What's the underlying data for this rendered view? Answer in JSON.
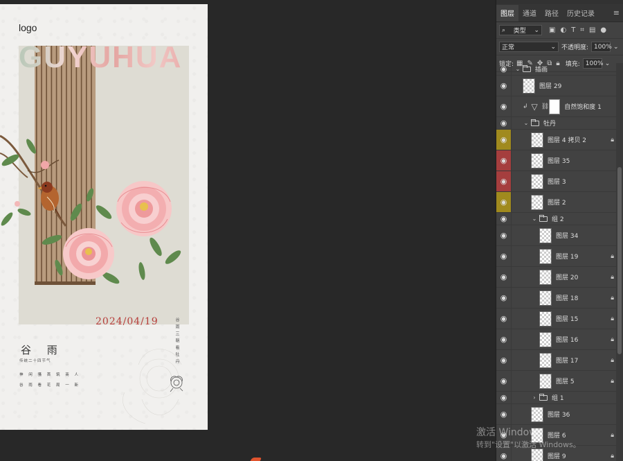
{
  "poster": {
    "logo": "logo",
    "big_title": "GUYUHUA",
    "date": "2024/04/19",
    "solar_term": "谷 雨",
    "solar_term_sub": "传统二十四节气",
    "poem_line1": "神 闲 骚 首 筑 商 人",
    "poem_line2": "谷 雨 看 花 局 一 新",
    "vertical_text": "谷雨三朝看牡丹"
  },
  "panel": {
    "tabs": [
      "图层",
      "通道",
      "路径",
      "历史记录"
    ],
    "active_tab": 0,
    "filter_kind": "类型",
    "blend_mode": "正常",
    "opacity_label": "不透明度:",
    "opacity_value": "100%",
    "lock_label": "锁定:",
    "fill_label": "填充:",
    "fill_value": "100%"
  },
  "layers": [
    {
      "type": "group",
      "name": "插画",
      "indent": 0,
      "expanded": true,
      "color": ""
    },
    {
      "type": "layer",
      "name": "图层 29",
      "indent": 1,
      "locked": false,
      "color": ""
    },
    {
      "type": "adjust",
      "name": "自然饱和度 1",
      "indent": 1,
      "locked": false,
      "color": ""
    },
    {
      "type": "group",
      "name": "牡丹",
      "indent": 1,
      "expanded": true,
      "color": ""
    },
    {
      "type": "layer",
      "name": "图层 4 拷贝 2",
      "indent": 2,
      "locked": true,
      "color": "yellow"
    },
    {
      "type": "layer",
      "name": "图层 35",
      "indent": 2,
      "locked": false,
      "color": "red"
    },
    {
      "type": "layer",
      "name": "图层 3",
      "indent": 2,
      "locked": false,
      "color": "red"
    },
    {
      "type": "layer",
      "name": "图层 2",
      "indent": 2,
      "locked": false,
      "color": "yellow"
    },
    {
      "type": "group",
      "name": "组 2",
      "indent": 2,
      "expanded": true,
      "color": ""
    },
    {
      "type": "layer",
      "name": "图层 34",
      "indent": 3,
      "locked": false,
      "color": ""
    },
    {
      "type": "layer",
      "name": "图层 19",
      "indent": 3,
      "locked": true,
      "color": ""
    },
    {
      "type": "layer",
      "name": "图层 20",
      "indent": 3,
      "locked": true,
      "color": ""
    },
    {
      "type": "layer",
      "name": "图层 18",
      "indent": 3,
      "locked": true,
      "color": ""
    },
    {
      "type": "layer",
      "name": "图层 15",
      "indent": 3,
      "locked": true,
      "color": ""
    },
    {
      "type": "layer",
      "name": "图层 16",
      "indent": 3,
      "locked": true,
      "color": ""
    },
    {
      "type": "layer",
      "name": "图层 17",
      "indent": 3,
      "locked": true,
      "color": ""
    },
    {
      "type": "layer",
      "name": "图层 5",
      "indent": 3,
      "locked": true,
      "color": ""
    },
    {
      "type": "group",
      "name": "组 1",
      "indent": 2,
      "expanded": false,
      "color": ""
    },
    {
      "type": "layer",
      "name": "图层 36",
      "indent": 2,
      "locked": false,
      "color": ""
    },
    {
      "type": "layer",
      "name": "图层 6",
      "indent": 2,
      "locked": true,
      "color": ""
    },
    {
      "type": "layer",
      "name": "图层 9",
      "indent": 2,
      "locked": true,
      "color": ""
    }
  ],
  "watermark": {
    "line1": "激活 Windows",
    "line2": "转到\"设置\"以激活 Windows。"
  },
  "colors": {
    "workspace": "#282828",
    "panel": "#424242",
    "date_red": "#b63d3a",
    "label_yellow": "#a08a1e",
    "label_red": "#a53e3e"
  }
}
